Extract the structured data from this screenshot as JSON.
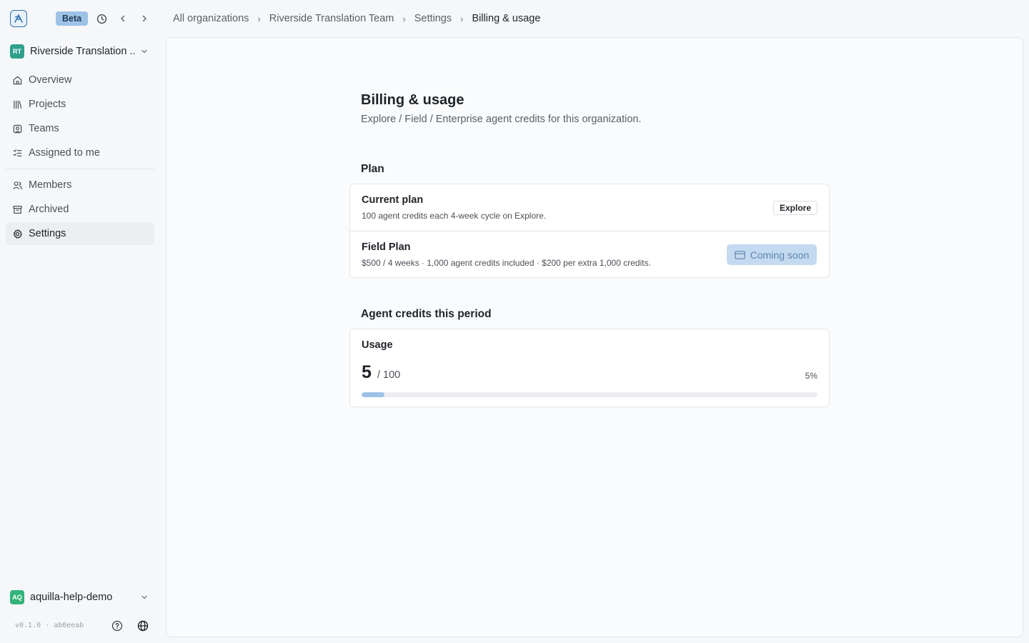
{
  "header": {
    "beta_label": "Beta",
    "breadcrumb": [
      "All organizations",
      "Riverside Translation Team",
      "Settings",
      "Billing & usage"
    ]
  },
  "sidebar": {
    "org_initials": "RT",
    "org_name": "Riverside Translation ...",
    "items": [
      {
        "label": "Overview",
        "icon": "home-icon"
      },
      {
        "label": "Projects",
        "icon": "library-icon"
      },
      {
        "label": "Teams",
        "icon": "team-icon"
      },
      {
        "label": "Assigned to me",
        "icon": "checklist-icon"
      },
      {
        "label": "Members",
        "icon": "users-icon"
      },
      {
        "label": "Archived",
        "icon": "archive-icon"
      },
      {
        "label": "Settings",
        "icon": "gear-icon",
        "active": true
      }
    ],
    "user_initials": "AQ",
    "user_name": "aquilla-help-demo",
    "version": "v0.1.0 · ab0eeab"
  },
  "page": {
    "title": "Billing & usage",
    "subtitle": "Explore / Field / Enterprise agent credits for this organization."
  },
  "plan": {
    "section_title": "Plan",
    "current_title": "Current plan",
    "current_desc": "100 agent credits each 4-week cycle on Explore.",
    "current_badge": "Explore",
    "field_title": "Field Plan",
    "field_desc": "$500 / 4 weeks · 1,000 agent credits included · $200 per extra 1,000 credits.",
    "field_button": "Coming soon"
  },
  "credits": {
    "section_title": "Agent credits this period",
    "usage_title": "Usage",
    "used": "5",
    "total_label": "/ 100",
    "percent_label": "5%",
    "progress_fraction": 0.05
  },
  "colors": {
    "accent": "#9ec2e6",
    "active_nav": "#eceef1",
    "org_avatar": "#2fa08a",
    "user_avatar": "#34b37a"
  }
}
